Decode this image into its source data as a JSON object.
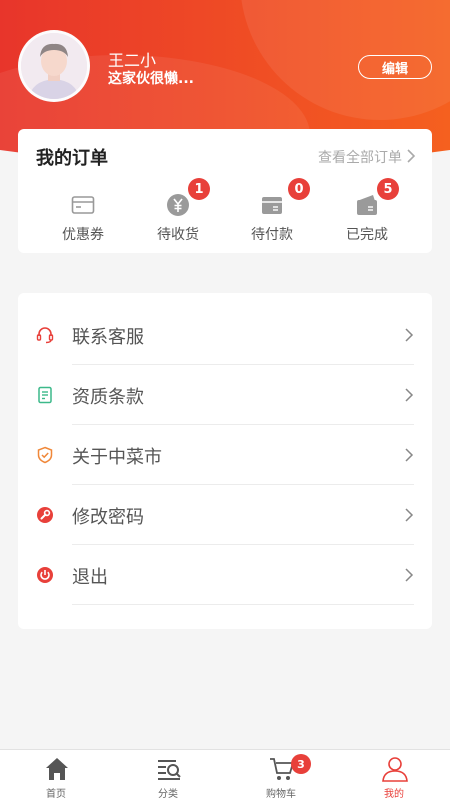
{
  "profile": {
    "name": "王二小",
    "signature": "这家伙很懒...",
    "edit_label": "编辑"
  },
  "orders": {
    "title": "我的订单",
    "view_all": "查看全部订单",
    "items": [
      {
        "label": "优惠券",
        "icon": "coupon-card-icon"
      },
      {
        "label": "待收货",
        "icon": "yen-coin-icon",
        "badge": "1"
      },
      {
        "label": "待付款",
        "icon": "wallet-box-icon",
        "badge": "0"
      },
      {
        "label": "已完成",
        "icon": "wallet-check-icon",
        "badge": "5"
      }
    ]
  },
  "menu": {
    "items": [
      {
        "label": "联系客服",
        "icon": "headset-icon",
        "color": "#e8403a"
      },
      {
        "label": "资质条款",
        "icon": "document-icon",
        "color": "#3cb98a"
      },
      {
        "label": "关于中菜市",
        "icon": "shield-check-icon",
        "color": "#f0883a"
      },
      {
        "label": "修改密码",
        "icon": "wrench-icon",
        "color": "#e8403a"
      },
      {
        "label": "退出",
        "icon": "power-icon",
        "color": "#e8403a"
      }
    ]
  },
  "tabbar": {
    "items": [
      {
        "label": "首页",
        "icon": "home-icon"
      },
      {
        "label": "分类",
        "icon": "category-search-icon"
      },
      {
        "label": "购物车",
        "icon": "cart-icon",
        "badge": "3"
      },
      {
        "label": "我的",
        "icon": "user-icon",
        "active": true
      }
    ]
  },
  "colors": {
    "accent": "#e8403a",
    "header_start": "#e8352b",
    "header_end": "#f5601f"
  }
}
